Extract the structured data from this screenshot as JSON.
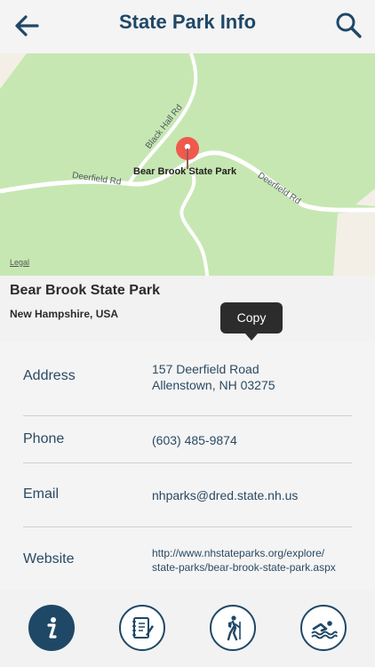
{
  "header": {
    "title": "State Park Info"
  },
  "map": {
    "park_label": "Bear Brook State Park",
    "legal": "Legal",
    "roads": [
      {
        "label": "Black Hall Rd"
      },
      {
        "label": "Deerfield Rd"
      },
      {
        "label": "Deerfield Rd"
      }
    ]
  },
  "place": {
    "name": "Bear Brook State Park",
    "region": "New Hampshire, USA"
  },
  "tooltip": {
    "label": "Copy"
  },
  "info": {
    "address_label": "Address",
    "address_line1": "157 Deerfield Road",
    "address_line2": "Allenstown, NH 03275",
    "phone_label": "Phone",
    "phone_value": "(603) 485-9874",
    "email_label": "Email",
    "email_value": "nhparks@dred.state.nh.us",
    "website_label": "Website",
    "website_line1": "http://www.nhstateparks.org/explore/",
    "website_line2": "state-parks/bear-brook-state-park.aspx"
  },
  "colors": {
    "primary": "#1f4867",
    "map_green": "#c6e7b2",
    "pin_red": "#f0594e"
  },
  "tabs": [
    {
      "icon": "info-icon",
      "active": true
    },
    {
      "icon": "notebook-icon",
      "active": false
    },
    {
      "icon": "hiker-icon",
      "active": false
    },
    {
      "icon": "swimmer-icon",
      "active": false
    }
  ]
}
